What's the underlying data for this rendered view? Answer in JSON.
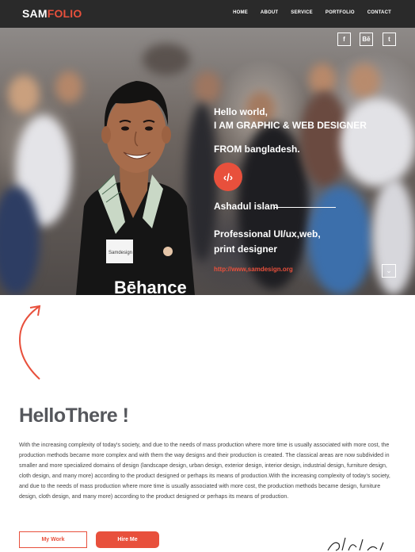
{
  "brand": {
    "part1": "SAM",
    "part2": "FOLIO"
  },
  "nav": {
    "home": "HOME",
    "about": "ABOUT",
    "service": "SERVICE",
    "portfolio": "PORTFOLIO",
    "contact": "CONTACT"
  },
  "social": {
    "facebook": "f",
    "behance": "Bē",
    "twitter": "t"
  },
  "hero": {
    "greeting_line1": "Hello world,",
    "greeting_line2": "I AM GRAPHIC & WEB DESIGNER",
    "from": "FROM bangladesh.",
    "code_icon": "‹/›",
    "name": "Ashadul islam",
    "role": "Professional UI/ux,web, print designer",
    "url": "http://www,samdesign.org",
    "shirt_text": "Bēhance",
    "badge_text": "Samdesign"
  },
  "about": {
    "hello_bold": "Hello",
    "hello_rest": "There !",
    "paragraph": "With the increasing complexity of today's society, and due to the needs of mass production where more time is usually associated with more cost, the production methods became more complex and with them the way designs and their production is created. The classical areas are now subdivided in smaller and more specialized domains of design (landscape design, urban design, exterior design, interior design, industrial design, furniture design, cloth design, and many more) according to the product designed or perhaps its means of production.With the increasing complexity of today's society, and due to the needs of mass production where more time is usually associated with more cost, the production methods became design, furniture design, cloth design, and many more) according to the product designed or perhaps its means of production.",
    "my_work": "My Work",
    "hire_me": "Hire Me"
  },
  "colors": {
    "accent": "#e8503c",
    "navbar": "#2a2a2a",
    "heading": "#55575c"
  }
}
